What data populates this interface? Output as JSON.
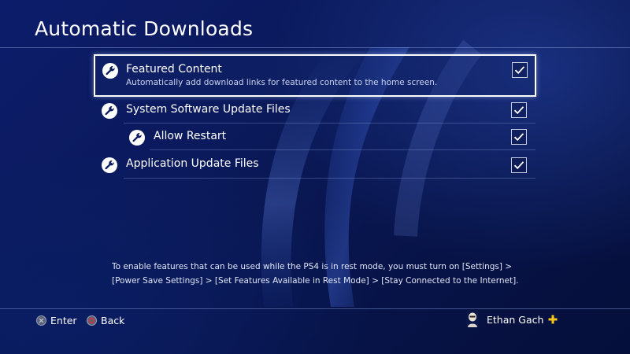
{
  "page": {
    "title": "Automatic Downloads"
  },
  "settings": [
    {
      "label": "Featured Content",
      "description": "Automatically add download links for featured content to the home screen.",
      "checked": true,
      "icon": "wrench-icon"
    },
    {
      "label": "System Software Update Files",
      "checked": true,
      "icon": "wrench-icon"
    },
    {
      "label": "Allow Restart",
      "checked": true,
      "icon": "wrench-icon"
    },
    {
      "label": "Application Update Files",
      "checked": true,
      "icon": "wrench-icon"
    }
  ],
  "note": "To enable features that can be used while the PS4 is in rest mode, you must turn on [Settings] > [Power Save Settings] > [Set Features Available in Rest Mode] > [Stay Connected to the Internet].",
  "footer": {
    "enter_label": "Enter",
    "enter_icon": "cross-button-icon",
    "back_label": "Back",
    "back_icon": "circle-button-icon",
    "user_name": "Ethan Gach",
    "plus_icon": "playstation-plus-icon"
  },
  "colors": {
    "background": "#0b1a5c",
    "accent_plus": "#f5c518",
    "circle_button_red": "#e0303a"
  }
}
